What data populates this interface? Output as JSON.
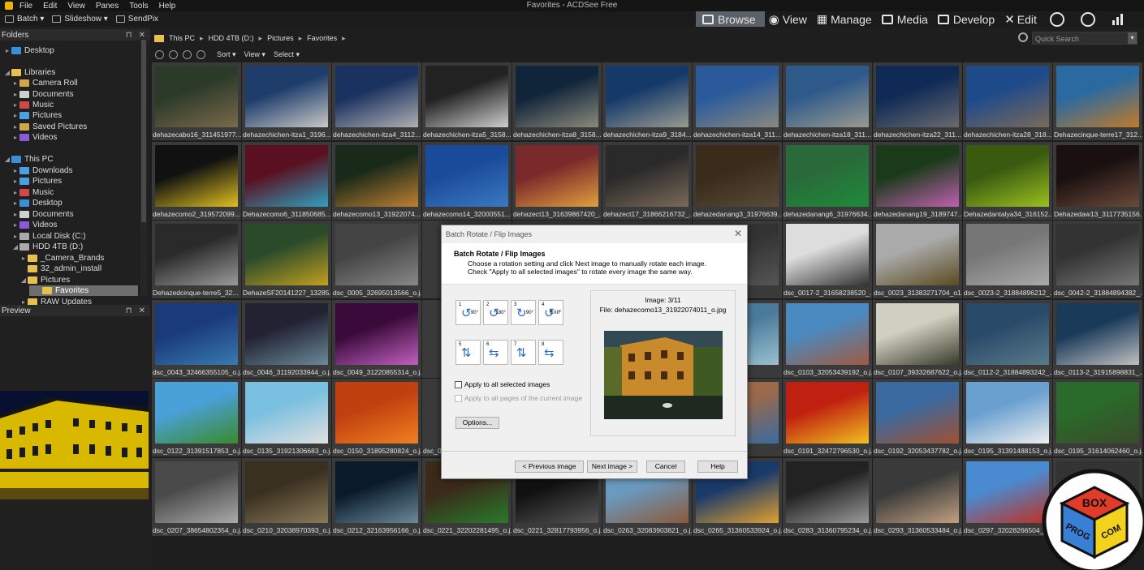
{
  "window": {
    "title": "Favorites - ACDSee Free"
  },
  "menu": [
    "File",
    "Edit",
    "View",
    "Panes",
    "Tools",
    "Help"
  ],
  "toolbar": {
    "batch": "Batch",
    "slideshow": "Slideshow",
    "sendpix": "SendPix"
  },
  "modes": [
    {
      "label": "Browse",
      "active": true
    },
    {
      "label": "View"
    },
    {
      "label": "Manage"
    },
    {
      "label": "Media"
    },
    {
      "label": "Develop"
    },
    {
      "label": "Edit"
    }
  ],
  "folders_pane": {
    "title": "Folders",
    "tree": [
      {
        "label": "Desktop",
        "indent": 1,
        "arrow": "▸",
        "color": "#3b8ed8"
      },
      {
        "label": "Libraries",
        "indent": 1,
        "arrow": "◢",
        "color": "#e8c050"
      },
      {
        "label": "Camera Roll",
        "indent": 2,
        "arrow": "▸",
        "color": "#cfa64a"
      },
      {
        "label": "Documents",
        "indent": 2,
        "arrow": "▸",
        "color": "#cfcfcf"
      },
      {
        "label": "Music",
        "indent": 2,
        "arrow": "▸",
        "color": "#d04848"
      },
      {
        "label": "Pictures",
        "indent": 2,
        "arrow": "▸",
        "color": "#4aa0e0"
      },
      {
        "label": "Saved Pictures",
        "indent": 2,
        "arrow": "▸",
        "color": "#cfa64a"
      },
      {
        "label": "Videos",
        "indent": 2,
        "arrow": "▸",
        "color": "#8a5ad8"
      },
      {
        "label": "This PC",
        "indent": 1,
        "arrow": "◢",
        "color": "#3b8ed8"
      },
      {
        "label": "Downloads",
        "indent": 2,
        "arrow": "▸",
        "color": "#4aa0e0"
      },
      {
        "label": "Pictures",
        "indent": 2,
        "arrow": "▸",
        "color": "#4aa0e0"
      },
      {
        "label": "Music",
        "indent": 2,
        "arrow": "▸",
        "color": "#d04848"
      },
      {
        "label": "Desktop",
        "indent": 2,
        "arrow": "▸",
        "color": "#3b8ed8"
      },
      {
        "label": "Documents",
        "indent": 2,
        "arrow": "▸",
        "color": "#cfcfcf"
      },
      {
        "label": "Videos",
        "indent": 2,
        "arrow": "▸",
        "color": "#8a5ad8"
      },
      {
        "label": "Local Disk (C:)",
        "indent": 2,
        "arrow": "▸",
        "color": "#aaaaaa"
      },
      {
        "label": "HDD 4TB (D:)",
        "indent": 2,
        "arrow": "◢",
        "color": "#aaaaaa"
      },
      {
        "label": "_Camera_Brands",
        "indent": 3,
        "arrow": "▸",
        "color": "#e8c050"
      },
      {
        "label": "32_admin_install",
        "indent": 3,
        "arrow": "",
        "color": "#e8c050"
      },
      {
        "label": "Pictures",
        "indent": 3,
        "arrow": "◢",
        "color": "#e8c050"
      },
      {
        "label": "Favorites",
        "indent": 4,
        "arrow": "",
        "color": "#e8c050",
        "selected": true
      },
      {
        "label": "RAW Updates",
        "indent": 3,
        "arrow": "▸",
        "color": "#e8c050"
      }
    ]
  },
  "preview_pane": {
    "title": "Preview"
  },
  "address": {
    "crumbs": [
      "This PC",
      "HDD 4TB (D:)",
      "Pictures",
      "Favorites"
    ],
    "search_placeholder": "Quick Search"
  },
  "navbar": {
    "sort": "Sort",
    "view": "View",
    "select": "Select"
  },
  "thumbnails": [
    "dehazecabo16_311451977...",
    "dehazechichen-itza1_3196...",
    "dehazechichen-itza4_3112...",
    "dehazechichen-itza5_3158...",
    "dehazechichen-itza8_3158...",
    "dehazechichen-itza9_3184...",
    "dehazechichen-itza14_311...",
    "dehazechichen-itza18_311...",
    "dehazechichen-itza22_311...",
    "dehazechichen-itza28_318...",
    "Dehazecinque-terre17_312...",
    "dehazecomo2_319572099...",
    "Dehazecomo6_311850685...",
    "dehazecomo13_31922074...",
    "dehazecomo14_32000551...",
    "dehazect13_31639867420_...",
    "dehazect17_31866216732_...",
    "dehazedanang3_31976639...",
    "dehazedanang6_31976634...",
    "dehazedanang19_3189747...",
    "Dehazedantalya34_316152...",
    "Dehazedaw13_3117735156...",
    "Dehazedcinque-terre5_32...",
    "DehazeSF20141227_13285...",
    "dsc_0005_32695013566_o.j...",
    "",
    "",
    "",
    "...78736_o.j...",
    "dsc_0017-2_31658238520_...",
    "dsc_0023_31383271704_o1...",
    "dsc_0023-2_31884896212_...",
    "dsc_0042-2_31884894382_...",
    "dsc_0043_32466355105_o.j...",
    "dsc_0046_31192033944_o.j...",
    "dsc_0049_31220855314_o.j...",
    "",
    "",
    "",
    "...2970074_...",
    "dsc_0103_32053439192_o.j...",
    "dsc_0107_39332687622_o.j...",
    "dsc_0112-2_31884893242_...",
    "dsc_0113-2_31915898831_...",
    "dsc_0122_31391517853_o.j...",
    "dsc_0135_31921306683_o.j...",
    "dsc_0150_31895280824_o.j...",
    "dsc_0...",
    "",
    "",
    "...1695_o.j...",
    "dsc_0191_32472796530_o.j...",
    "dsc_0192_32053437782_o.j...",
    "dsc_0195_31391488153_o.j...",
    "dsc_0195_31614062460_o.j...",
    "dsc_0207_38654802354_o.j...",
    "dsc_0210_32038970393_o.j...",
    "dsc_0212_32163956166_o.j...",
    "dsc_0221_32202281495_o.j...",
    "dsc_0221_32817793956_o.j...",
    "dsc_0263_32083903821_o.j...",
    "dsc_0265_31360533924_o.j...",
    "dsc_0283_31360795234_o.j...",
    "dsc_0293_31360533484_o.j...",
    "dsc_0297_32028266504_o.j...",
    ""
  ],
  "dialog": {
    "title": "Batch Rotate / Flip Images",
    "heading": "Batch Rotate / Flip Images",
    "desc1": "Choose a rotation setting and click Next image to manually rotate each image.",
    "desc2": "Check \"Apply to all selected images\" to rotate every image the same way.",
    "rotate_buttons": [
      {
        "n": "1",
        "tag": "90°"
      },
      {
        "n": "2",
        "tag": "180°"
      },
      {
        "n": "3",
        "tag": "90°"
      },
      {
        "n": "4",
        "tag": "EXIF"
      },
      {
        "n": "5",
        "tag": ""
      },
      {
        "n": "6",
        "tag": ""
      },
      {
        "n": "7",
        "tag": ""
      },
      {
        "n": "8",
        "tag": ""
      }
    ],
    "apply_all": "Apply to all selected images",
    "apply_pages": "Apply to all pages of the current image",
    "options": "Options...",
    "image_counter": "Image: 3/11",
    "file_label": "File: dehazecomo13_31922074011_o.jpg",
    "prev": "< Previous image",
    "next": "Next image >",
    "cancel": "Cancel",
    "help": "Help"
  },
  "watermark": {
    "line1": "BOX",
    "line2": "PROG",
    "line3": "COM"
  }
}
